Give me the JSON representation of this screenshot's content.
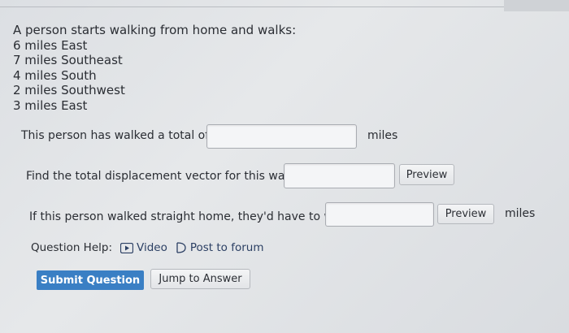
{
  "problem": {
    "intro": "A person starts walking from home and walks:",
    "legs": [
      "6 miles East",
      "7 miles Southeast",
      "4 miles South",
      "2 miles Southwest",
      "3 miles East"
    ]
  },
  "q1": {
    "prompt": "This person has walked a total of",
    "value": "",
    "unit": "miles"
  },
  "q2": {
    "prompt": "Find the total displacement vector for this walk:",
    "value": "",
    "preview_label": "Preview"
  },
  "q3": {
    "prompt": "If this person walked straight home, they'd have to walk",
    "value": "",
    "preview_label": "Preview",
    "unit": "miles"
  },
  "help": {
    "label": "Question Help:",
    "video_label": "Video",
    "forum_label": "Post to forum"
  },
  "actions": {
    "submit_label": "Submit Question",
    "jump_label": "Jump to Answer"
  },
  "colors": {
    "primary": "#3a7fc4",
    "background": "#e2e4e7"
  }
}
